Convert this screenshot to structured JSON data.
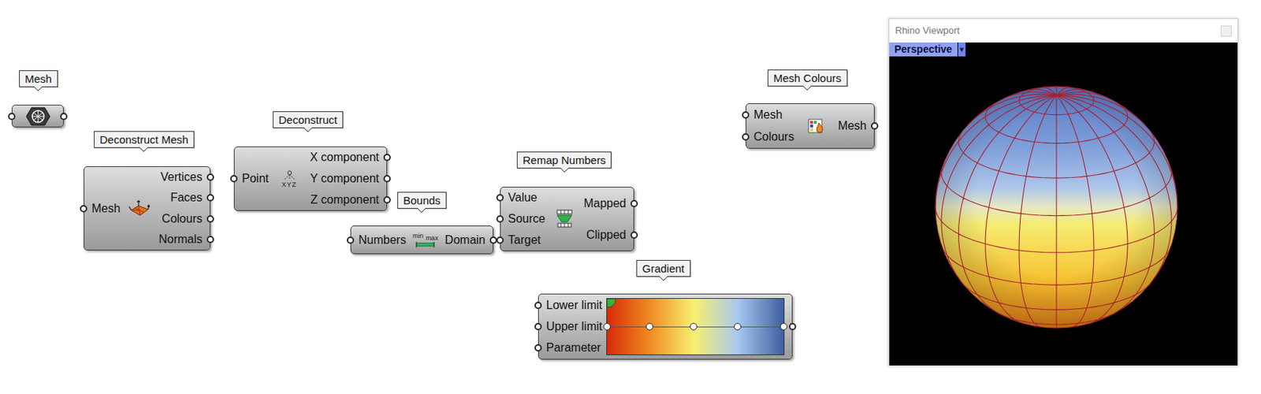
{
  "canvas": {
    "nodes": {
      "mesh": {
        "kind": "param",
        "label": "Mesh"
      },
      "deconstruct_mesh": {
        "kind": "component",
        "label": "Deconstruct Mesh",
        "inputs": [
          "Mesh"
        ],
        "outputs": [
          "Vertices",
          "Faces",
          "Colours",
          "Normals"
        ]
      },
      "deconstruct": {
        "kind": "component",
        "label": "Deconstruct",
        "inputs": [
          "Point"
        ],
        "outputs": [
          "X component",
          "Y component",
          "Z component"
        ],
        "icon_text": [
          "XYZ"
        ]
      },
      "bounds": {
        "kind": "component",
        "label": "Bounds",
        "inputs": [
          "Numbers"
        ],
        "outputs": [
          "Domain"
        ],
        "icon_text": [
          "min",
          "max"
        ]
      },
      "remap": {
        "kind": "component",
        "label": "Remap Numbers",
        "inputs": [
          "Value",
          "Source",
          "Target"
        ],
        "outputs": [
          "Mapped",
          "Clipped"
        ]
      },
      "gradient": {
        "kind": "gradient",
        "label": "Gradient",
        "inputs": [
          "Lower limit",
          "Upper limit",
          "Parameter"
        ],
        "stops": [
          {
            "level": 0,
            "color": "#d62a08"
          },
          {
            "level": 0.24,
            "color": "#f08a22"
          },
          {
            "level": 0.49,
            "color": "#f8f070"
          },
          {
            "level": 0.74,
            "color": "#a8c8f0"
          },
          {
            "level": 1,
            "color": "#3e5e9e"
          }
        ]
      },
      "mesh_colours": {
        "kind": "component",
        "label": "Mesh Colours",
        "inputs": [
          "Mesh",
          "Colours"
        ],
        "outputs": [
          "Mesh"
        ]
      }
    },
    "wires": [
      {
        "from": "mesh:out:0",
        "to": "deconstruct_mesh:in:0"
      },
      {
        "from": "mesh:out:0",
        "to": "mesh_colours:in:0"
      },
      {
        "from": "deconstruct_mesh:out:0",
        "to": "deconstruct:in:0"
      },
      {
        "from": "deconstruct:out:2",
        "to": "remap:in:0"
      },
      {
        "from": "deconstruct:out:2",
        "to": "bounds:in:0"
      },
      {
        "from": "bounds:out:0",
        "to": "remap:in:1"
      },
      {
        "from": "remap:out:0",
        "to": "gradient:in:2"
      },
      {
        "from": "gradient:out:0",
        "to": "mesh_colours:in:1"
      }
    ]
  },
  "viewport": {
    "title": "Rhino Viewport",
    "view": "Perspective",
    "view_menu": "▾"
  }
}
